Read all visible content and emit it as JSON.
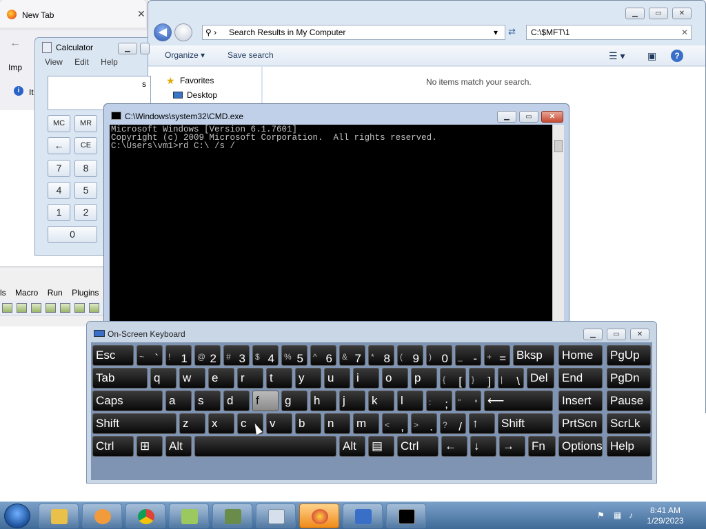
{
  "firefox": {
    "tab_title": "New Tab",
    "close_glyph": "✕",
    "back_glyph": "←",
    "import_label": "Imp",
    "info_text": "It"
  },
  "explorer": {
    "address": "Search Results in My Computer",
    "search_value": "C:\\$MFT\\1",
    "organize": "Organize ▾",
    "save_search": "Save search",
    "favorites": "Favorites",
    "desktop": "Desktop",
    "empty_message": "No items match your search.",
    "help_glyph": "?"
  },
  "calculator": {
    "title": "Calculator",
    "menu": [
      "View",
      "Edit",
      "Help"
    ],
    "display_fragment": "s",
    "keys": [
      "MC",
      "MR",
      "←",
      "CE",
      "7",
      "8",
      "4",
      "5",
      "1",
      "2",
      "0"
    ]
  },
  "cmd": {
    "title": "C:\\Windows\\system32\\CMD.exe",
    "lines": [
      "Microsoft Windows [Version 6.1.7601]",
      "Copyright (c) 2009 Microsoft Corporation.  All rights reserved.",
      "",
      "C:\\Users\\vm1>rd C:\\ /s /"
    ]
  },
  "notepadpp": {
    "menu": [
      "ls",
      "Macro",
      "Run",
      "Plugins"
    ]
  },
  "osk": {
    "title": "On-Screen Keyboard",
    "rows": [
      [
        {
          "l": "Esc"
        },
        {
          "s": "~",
          "c": "`"
        },
        {
          "s": "!",
          "c": "1"
        },
        {
          "s": "@",
          "c": "2"
        },
        {
          "s": "#",
          "c": "3"
        },
        {
          "s": "$",
          "c": "4"
        },
        {
          "s": "%",
          "c": "5"
        },
        {
          "s": "^",
          "c": "6"
        },
        {
          "s": "&",
          "c": "7"
        },
        {
          "s": "*",
          "c": "8"
        },
        {
          "s": "(",
          "c": "9"
        },
        {
          "s": ")",
          "c": "0"
        },
        {
          "s": "_",
          "c": "-"
        },
        {
          "s": "+",
          "c": "="
        },
        {
          "l": "Bksp"
        },
        {
          "l": "Home"
        },
        {
          "l": "PgUp"
        }
      ],
      [
        {
          "l": "Tab"
        },
        {
          "l": "q"
        },
        {
          "l": "w"
        },
        {
          "l": "e"
        },
        {
          "l": "r"
        },
        {
          "l": "t"
        },
        {
          "l": "y"
        },
        {
          "l": "u"
        },
        {
          "l": "i"
        },
        {
          "l": "o"
        },
        {
          "l": "p"
        },
        {
          "s": "{",
          "c": "["
        },
        {
          "s": "}",
          "c": "]"
        },
        {
          "s": "|",
          "c": "\\"
        },
        {
          "l": "Del"
        },
        {
          "l": "End"
        },
        {
          "l": "PgDn"
        }
      ],
      [
        {
          "l": "Caps"
        },
        {
          "l": "a"
        },
        {
          "l": "s"
        },
        {
          "l": "d"
        },
        {
          "l": "f"
        },
        {
          "l": "g"
        },
        {
          "l": "h"
        },
        {
          "l": "j"
        },
        {
          "l": "k"
        },
        {
          "l": "l"
        },
        {
          "s": ":",
          "c": ";"
        },
        {
          "s": "\"",
          "c": "'"
        },
        {
          "l": "⟵"
        },
        {
          "l": "Insert"
        },
        {
          "l": "Pause"
        }
      ],
      [
        {
          "l": "Shift"
        },
        {
          "l": "z"
        },
        {
          "l": "x"
        },
        {
          "l": "c"
        },
        {
          "l": "v"
        },
        {
          "l": "b"
        },
        {
          "l": "n"
        },
        {
          "l": "m"
        },
        {
          "s": "<",
          "c": ","
        },
        {
          "s": ">",
          "c": "."
        },
        {
          "s": "?",
          "c": "/"
        },
        {
          "l": "↑"
        },
        {
          "l": "Shift"
        },
        {
          "l": "PrtScn"
        },
        {
          "l": "ScrLk"
        }
      ],
      [
        {
          "l": "Ctrl"
        },
        {
          "l": "⊞"
        },
        {
          "l": "Alt"
        },
        {
          "l": ""
        },
        {
          "l": "Alt"
        },
        {
          "l": "▤"
        },
        {
          "l": "Ctrl"
        },
        {
          "l": "←"
        },
        {
          "l": "↓"
        },
        {
          "l": "→"
        },
        {
          "l": "Fn"
        },
        {
          "l": "Options"
        },
        {
          "l": "Help"
        }
      ]
    ]
  },
  "taskbar": {
    "apps": [
      "explorer",
      "media-player",
      "chrome",
      "notepadpp",
      "game",
      "calculator",
      "firefox",
      "on-screen-keyboard",
      "cmd"
    ],
    "time": "8:41 AM",
    "date": "1/29/2023"
  }
}
